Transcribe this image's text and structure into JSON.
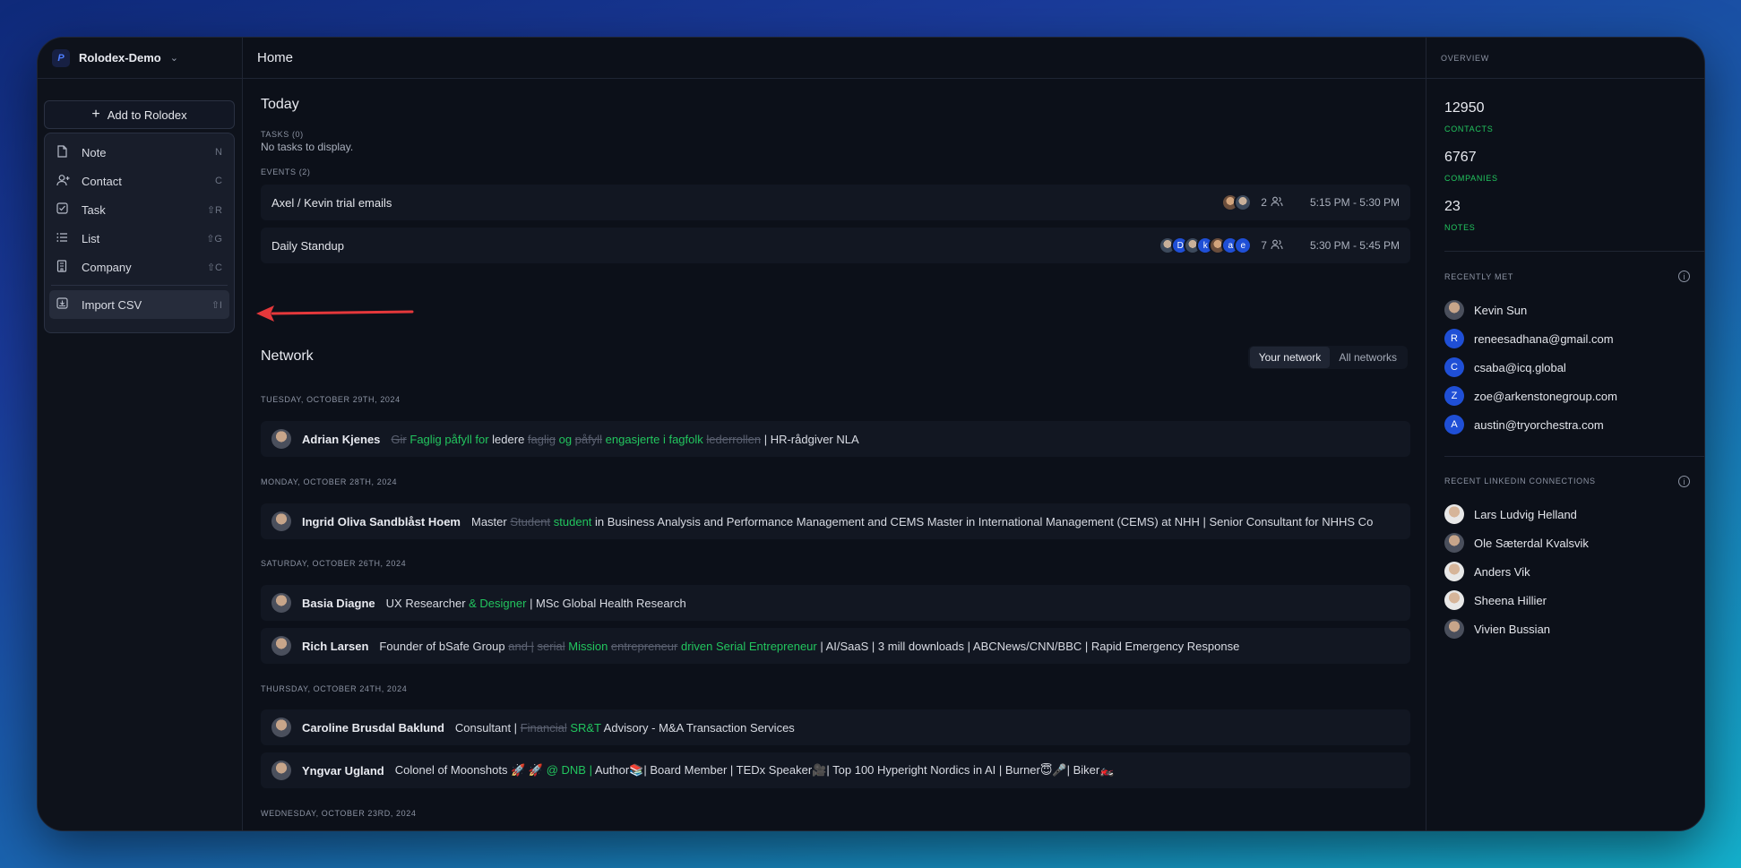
{
  "workspace": {
    "name": "Rolodex-Demo"
  },
  "sidebar": {
    "add_button": "Add to Rolodex",
    "menu": [
      {
        "label": "Note",
        "key": "N",
        "icon": "note-icon"
      },
      {
        "label": "Contact",
        "key": "C",
        "icon": "add-contact-icon"
      },
      {
        "label": "Task",
        "key": "⇧R",
        "icon": "task-checkbox-icon"
      },
      {
        "label": "List",
        "key": "⇧G",
        "icon": "list-icon"
      },
      {
        "label": "Company",
        "key": "⇧C",
        "icon": "building-icon"
      }
    ],
    "import": {
      "label": "Import CSV",
      "key": "⇧I",
      "icon": "import-icon"
    }
  },
  "main": {
    "title": "Home",
    "today": {
      "title": "Today",
      "tasks_label": "TASKS (0)",
      "tasks_empty": "No tasks to display.",
      "events_label": "EVENTS (2)",
      "events": [
        {
          "title": "Axel / Kevin trial emails",
          "count": "2",
          "time": "5:15 PM - 5:30 PM",
          "avatars": [
            "photo",
            "photo2"
          ]
        },
        {
          "title": "Daily Standup",
          "count": "7",
          "time": "5:30 PM - 5:45 PM",
          "avatars": [
            "photo2",
            "D",
            "photo2",
            "k",
            "photo",
            "a",
            "e"
          ]
        }
      ]
    },
    "network": {
      "title": "Network",
      "toggle": [
        "Your network",
        "All networks"
      ],
      "groups": [
        {
          "date": "TUESDAY, OCTOBER 29TH, 2024",
          "rows": [
            {
              "name": "Adrian Kjenes",
              "parts": [
                [
                  "d",
                  "Gir"
                ],
                [
                  "i",
                  " Faglig "
                ],
                [
                  "i",
                  " påfyll for "
                ],
                [
                  "n",
                  " ledere "
                ],
                [
                  "d",
                  "faglig"
                ],
                [
                  "i",
                  " og "
                ],
                [
                  "d",
                  " påfyll"
                ],
                [
                  "i",
                  " engasjerte "
                ],
                [
                  "i",
                  " i fagfolk "
                ],
                [
                  "d",
                  " lederrollen"
                ],
                [
                  "n",
                  " | HR-rådgiver NLA"
                ]
              ]
            }
          ]
        },
        {
          "date": "MONDAY, OCTOBER 28TH, 2024",
          "rows": [
            {
              "name": "Ingrid Oliva Sandblåst Hoem",
              "parts": [
                [
                  "n",
                  "Master "
                ],
                [
                  "d",
                  "Student"
                ],
                [
                  "i",
                  " student"
                ],
                [
                  "n",
                  " in Business Analysis and Performance Management and CEMS Master in International Management (CEMS) at NHH | Senior Consultant for NHHS Co"
                ]
              ]
            }
          ]
        },
        {
          "date": "SATURDAY, OCTOBER 26TH, 2024",
          "rows": [
            {
              "name": "Basia Diagne",
              "parts": [
                [
                  "n",
                  "UX Researcher "
                ],
                [
                  "i",
                  "& Designer"
                ],
                [
                  "n",
                  " | MSc Global Health Research"
                ]
              ]
            },
            {
              "name": "Rich Larsen",
              "parts": [
                [
                  "n",
                  "Founder of bSafe Group "
                ],
                [
                  "d",
                  "and |"
                ],
                [
                  "i",
                  " "
                ],
                [
                  "d",
                  " serial"
                ],
                [
                  "i",
                  " Mission "
                ],
                [
                  "d",
                  " entrepreneur"
                ],
                [
                  "i",
                  " driven  Serial Entrepreneur"
                ],
                [
                  "n",
                  " | AI/SaaS | 3 mill downloads | ABCNews/CNN/BBC | Rapid Emergency Response"
                ]
              ]
            }
          ]
        },
        {
          "date": "THURSDAY, OCTOBER 24TH, 2024",
          "rows": [
            {
              "name": "Caroline Brusdal Baklund",
              "parts": [
                [
                  "n",
                  "Consultant | "
                ],
                [
                  "d",
                  "Financial"
                ],
                [
                  "i",
                  " SR&T"
                ],
                [
                  "n",
                  " Advisory - M&A Transaction Services"
                ]
              ]
            },
            {
              "name": "Yngvar Ugland",
              "parts": [
                [
                  "n",
                  "Colonel of Moonshots 🚀 🚀 "
                ],
                [
                  "i",
                  " @ DNB |"
                ],
                [
                  "n",
                  " Author📚| Board Member | TEDx Speaker🎥| Top 100 Hyperight Nordics in AI | Burner😇🎤| Biker🏍️"
                ]
              ]
            }
          ]
        },
        {
          "date": "WEDNESDAY, OCTOBER 23RD, 2024",
          "rows": []
        }
      ]
    }
  },
  "overview": {
    "title": "OVERVIEW",
    "stats": [
      {
        "value": "12950",
        "label": "CONTACTS"
      },
      {
        "value": "6767",
        "label": "COMPANIES"
      },
      {
        "value": "23",
        "label": "NOTES"
      }
    ],
    "recently_met": {
      "title": "RECENTLY MET",
      "people": [
        {
          "name": "Kevin Sun",
          "avatar": "photo"
        },
        {
          "name": "reneesadhana@gmail.com",
          "avatar": "R"
        },
        {
          "name": "csaba@icq.global",
          "avatar": "C"
        },
        {
          "name": "zoe@arkenstonegroup.com",
          "avatar": "Z"
        },
        {
          "name": "austin@tryorchestra.com",
          "avatar": "A"
        }
      ]
    },
    "linkedin": {
      "title": "RECENT LINKEDIN CONNECTIONS",
      "people": [
        {
          "name": "Lars Ludvig Helland",
          "avatar": "photo-light"
        },
        {
          "name": "Ole Sæterdal Kvalsvik",
          "avatar": "photo"
        },
        {
          "name": "Anders Vik",
          "avatar": "photo-light"
        },
        {
          "name": "Sheena Hillier",
          "avatar": "photo-light"
        },
        {
          "name": "Vivien Bussian",
          "avatar": "photo"
        }
      ]
    }
  }
}
